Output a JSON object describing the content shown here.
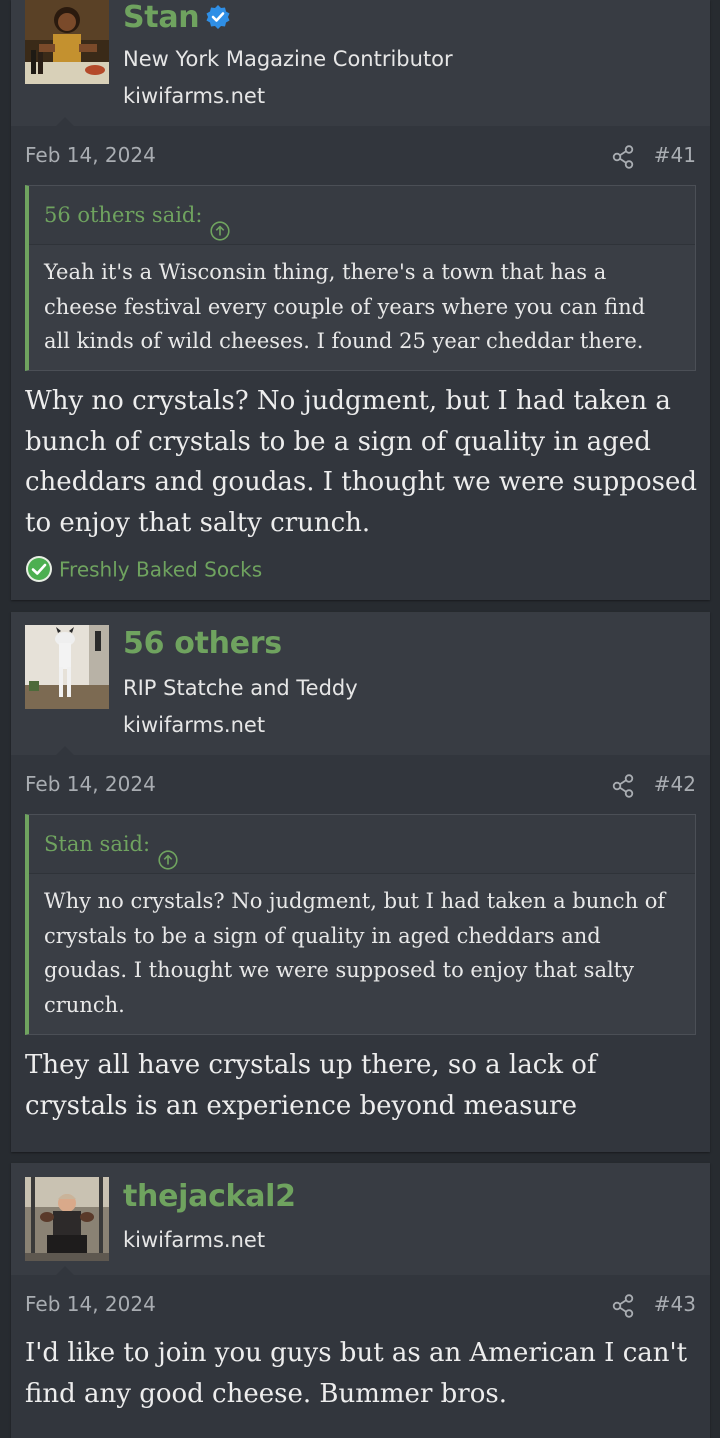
{
  "posts": [
    {
      "user": {
        "name": "Stan",
        "verified": true,
        "title": "New York Magazine Contributor",
        "site": "kiwifarms.net",
        "avatar_icon": "avatar-painting-man-with-wine"
      },
      "date": "Feb 14, 2024",
      "number": "#41",
      "quote": {
        "author": "56 others said:",
        "text": "Yeah it's a Wisconsin thing, there's a town that has a cheese festival every couple of years where you can find all kinds of wild cheeses. I found 25 year cheddar there."
      },
      "body": "Why no crystals? No judgment, but I had taken a bunch of crystals to be a sign of quality in aged cheddars and goudas. I thought we were supposed to enjoy that salty crunch.",
      "reaction": "Freshly Baked Socks"
    },
    {
      "user": {
        "name": "56 others",
        "title": "RIP Statche and Teddy",
        "site": "kiwifarms.net",
        "avatar_icon": "avatar-standing-cat"
      },
      "date": "Feb 14, 2024",
      "number": "#42",
      "quote": {
        "author": "Stan said:",
        "text": "Why no crystals? No judgment, but I had taken a bunch of crystals to be a sign of quality in aged cheddars and goudas. I thought we were supposed to enjoy that salty crunch."
      },
      "body": "They all have crystals up there, so a lack of crystals is an experience beyond measure"
    },
    {
      "user": {
        "name": "thejackal2",
        "site": "kiwifarms.net",
        "avatar_icon": "avatar-person-in-gym"
      },
      "date": "Feb 14, 2024",
      "number": "#43",
      "body": "I'd like to join you guys but as an American I can't find any good cheese. Bummer bros."
    }
  ],
  "colors": {
    "accent": "#6fa35f",
    "background": "#272b30",
    "post": "#32363d",
    "verified": "#2f8fe6"
  }
}
